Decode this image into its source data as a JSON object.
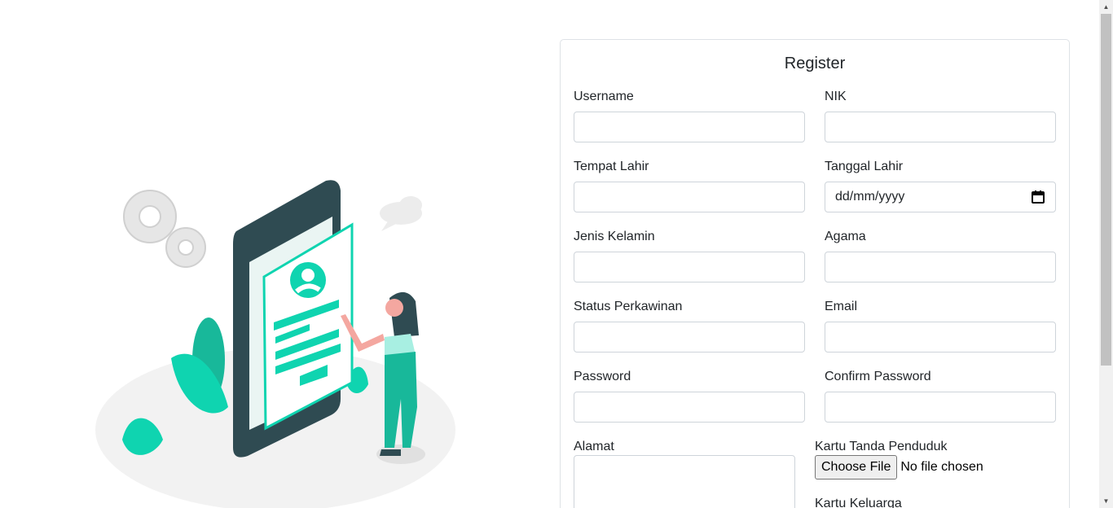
{
  "form": {
    "title": "Register",
    "fields": {
      "username": {
        "label": "Username",
        "value": ""
      },
      "nik": {
        "label": "NIK",
        "value": ""
      },
      "tempat_lahir": {
        "label": "Tempat Lahir",
        "value": ""
      },
      "tanggal_lahir": {
        "label": "Tanggal Lahir",
        "placeholder": "dd/mm/yyyy"
      },
      "jenis_kelamin": {
        "label": "Jenis Kelamin",
        "value": ""
      },
      "agama": {
        "label": "Agama",
        "value": ""
      },
      "status_perkawinan": {
        "label": "Status Perkawinan",
        "value": ""
      },
      "email": {
        "label": "Email",
        "value": ""
      },
      "password": {
        "label": "Password",
        "value": ""
      },
      "confirm_password": {
        "label": "Confirm Password",
        "value": ""
      },
      "alamat": {
        "label": "Alamat",
        "value": ""
      },
      "ktp": {
        "label": "Kartu Tanda Penduduk",
        "button": "Choose File",
        "status": "No file chosen"
      },
      "kk": {
        "label": "Kartu Keluarga"
      }
    }
  },
  "illustration": {
    "icons": [
      "gear-icon",
      "cloud-icon",
      "phone-icon",
      "person-icon",
      "plant-icon"
    ]
  },
  "colors": {
    "accent": "#0fd4b0",
    "dark": "#2f4b52",
    "border": "#ced4da"
  }
}
